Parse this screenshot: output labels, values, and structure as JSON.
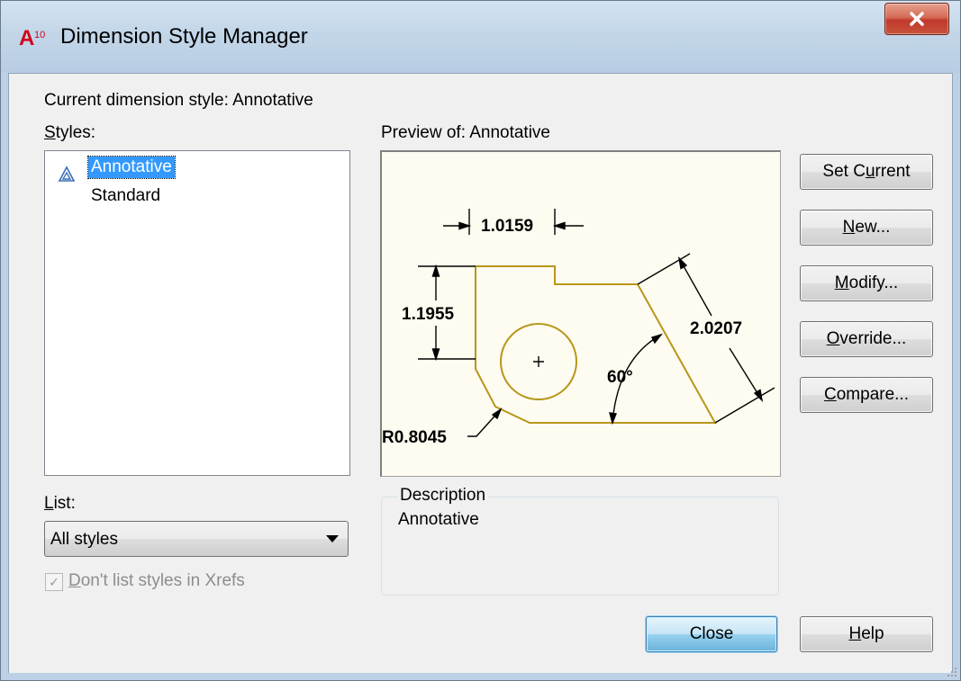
{
  "window": {
    "title": "Dimension Style Manager",
    "app_icon_text": "A",
    "app_icon_subtext": "10"
  },
  "current_style": "Current dimension style: Annotative",
  "styles": {
    "label_prefix": "",
    "label_mnemonic": "S",
    "label_rest": "tyles:",
    "items": [
      {
        "label": "Annotative",
        "selected": true,
        "icon": "annotative-icon"
      },
      {
        "label": "Standard",
        "selected": false
      }
    ]
  },
  "preview": {
    "label": "Preview of: Annotative",
    "dims": {
      "horizontal": "1.0159",
      "vertical": "1.1955",
      "aligned": "2.0207",
      "angle": "60°",
      "radius": "R0.8045"
    }
  },
  "list": {
    "label_mnemonic": "L",
    "label_rest": "ist:",
    "selected": "All styles"
  },
  "xref_checkbox": {
    "checked": true,
    "label_prefix": "",
    "label_mnemonic": "D",
    "label_rest": "on't list styles in Xrefs"
  },
  "description": {
    "legend": "Description",
    "text": "Annotative"
  },
  "buttons": {
    "set_current": {
      "prefix": "Set C",
      "mnemonic": "u",
      "rest": "rrent"
    },
    "new": {
      "prefix": "",
      "mnemonic": "N",
      "rest": "ew..."
    },
    "modify": {
      "prefix": "",
      "mnemonic": "M",
      "rest": "odify..."
    },
    "override": {
      "prefix": "",
      "mnemonic": "O",
      "rest": "verride..."
    },
    "compare": {
      "prefix": "",
      "mnemonic": "C",
      "rest": "ompare..."
    },
    "close": {
      "label": "Close"
    },
    "help": {
      "prefix": "",
      "mnemonic": "H",
      "rest": "elp"
    }
  },
  "colors": {
    "drawing_line": "#b8961a",
    "preview_bg": "#fefcf0",
    "selection": "#3399ff"
  }
}
